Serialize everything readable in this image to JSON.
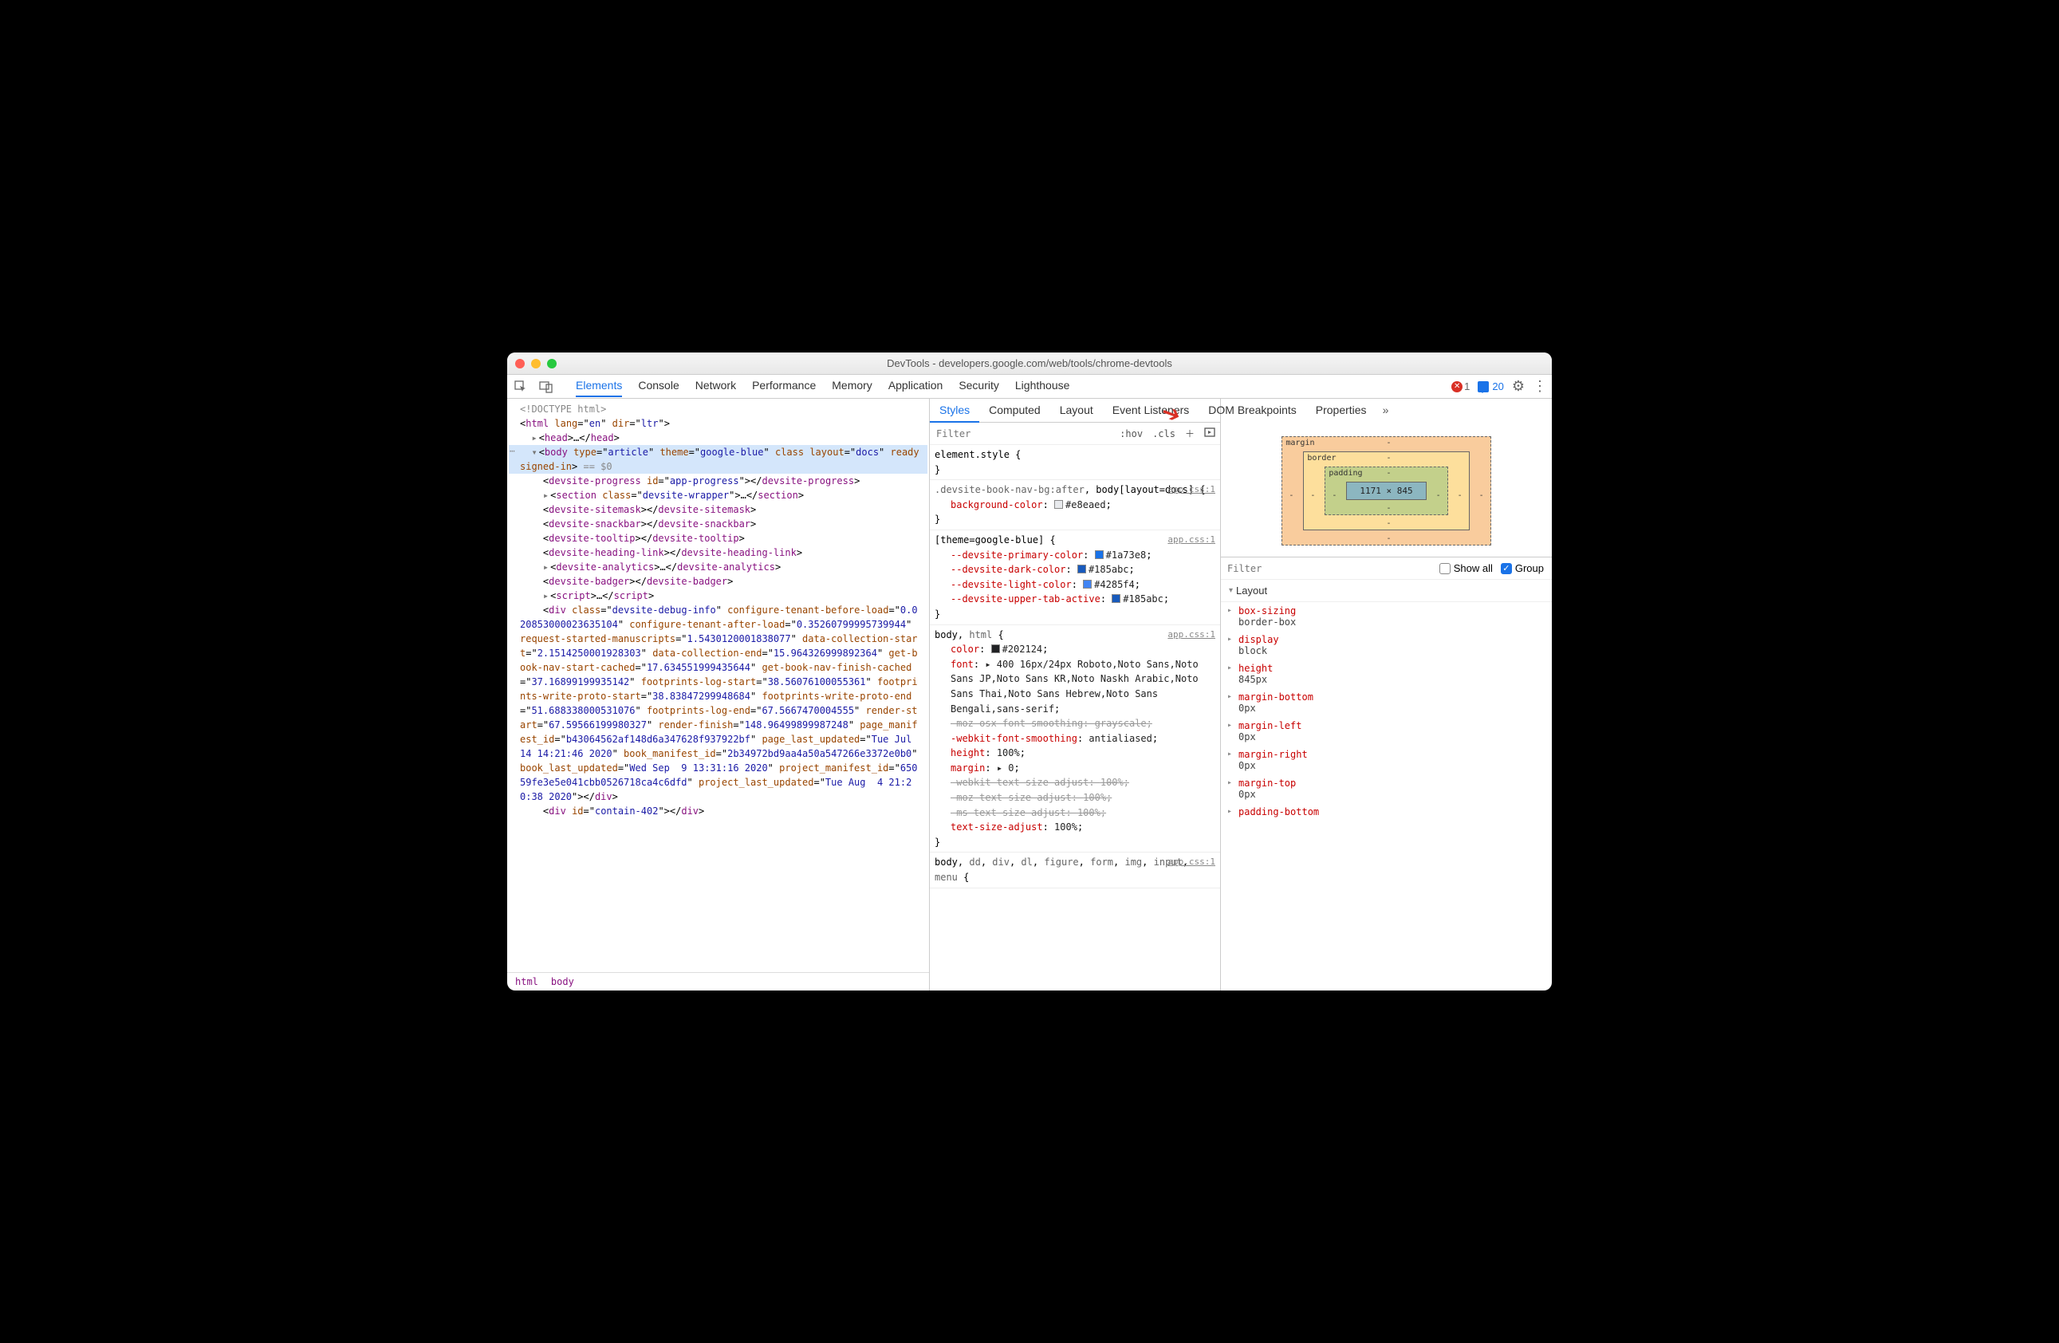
{
  "window": {
    "title": "DevTools - developers.google.com/web/tools/chrome-devtools"
  },
  "toolbar": {
    "tabs": [
      "Elements",
      "Console",
      "Network",
      "Performance",
      "Memory",
      "Application",
      "Security",
      "Lighthouse"
    ],
    "active_tab": "Elements",
    "error_count": "1",
    "message_count": "20"
  },
  "styles_panel": {
    "tabs": [
      "Styles",
      "Computed",
      "Layout",
      "Event Listeners",
      "DOM Breakpoints",
      "Properties"
    ],
    "active": "Styles",
    "filter_placeholder": "Filter",
    "hov": ":hov",
    "cls": ".cls"
  },
  "breadcrumb": [
    "html",
    "body"
  ],
  "dom_lines": [
    {
      "indent": 0,
      "html": "<span class='gray'>&lt;!DOCTYPE html&gt;</span>"
    },
    {
      "indent": 0,
      "html": "&lt;<span class='tag'>html</span> <span class='attr-n'>lang</span>=\"<span class='attr-v'>en</span>\" <span class='attr-n'>dir</span>=\"<span class='attr-v'>ltr</span>\"&gt;"
    },
    {
      "indent": 1,
      "tri": "▸",
      "html": "&lt;<span class='tag'>head</span>&gt;…&lt;/<span class='tag'>head</span>&gt;"
    },
    {
      "indent": 1,
      "tri": "▾",
      "selected": true,
      "html": "&lt;<span class='tag'>body</span> <span class='attr-n'>type</span>=\"<span class='attr-v'>article</span>\" <span class='attr-n'>theme</span>=\"<span class='attr-v'>google-blue</span>\" <span class='attr-n'>class</span> <span class='attr-n'>layout</span>=\"<span class='attr-v'>docs</span>\" <span class='attr-n'>ready</span> <span class='attr-n'>signed-in</span>&gt; <span class='gray'>== $0</span>"
    },
    {
      "indent": 2,
      "html": "&lt;<span class='tag'>devsite-progress</span> <span class='attr-n'>id</span>=\"<span class='attr-v'>app-progress</span>\"&gt;&lt;/<span class='tag'>devsite-progress</span>&gt;"
    },
    {
      "indent": 2,
      "tri": "▸",
      "html": "&lt;<span class='tag'>section</span> <span class='attr-n'>class</span>=\"<span class='attr-v'>devsite-wrapper</span>\"&gt;…&lt;/<span class='tag'>section</span>&gt;"
    },
    {
      "indent": 2,
      "html": "&lt;<span class='tag'>devsite-sitemask</span>&gt;&lt;/<span class='tag'>devsite-sitemask</span>&gt;"
    },
    {
      "indent": 2,
      "html": "&lt;<span class='tag'>devsite-snackbar</span>&gt;&lt;/<span class='tag'>devsite-snackbar</span>&gt;"
    },
    {
      "indent": 2,
      "html": "&lt;<span class='tag'>devsite-tooltip</span>&gt;&lt;/<span class='tag'>devsite-tooltip</span>&gt;"
    },
    {
      "indent": 2,
      "html": "&lt;<span class='tag'>devsite-heading-link</span>&gt;&lt;/<span class='tag'>devsite-heading-link</span>&gt;"
    },
    {
      "indent": 2,
      "tri": "▸",
      "html": "&lt;<span class='tag'>devsite-analytics</span>&gt;…&lt;/<span class='tag'>devsite-analytics</span>&gt;"
    },
    {
      "indent": 2,
      "html": "&lt;<span class='tag'>devsite-badger</span>&gt;&lt;/<span class='tag'>devsite-badger</span>&gt;"
    },
    {
      "indent": 2,
      "tri": "▸",
      "html": "&lt;<span class='tag'>script</span>&gt;…&lt;/<span class='tag'>script</span>&gt;"
    },
    {
      "indent": 2,
      "html": "&lt;<span class='tag'>div</span> <span class='attr-n'>class</span>=\"<span class='attr-v'>devsite-debug-info</span>\" <span class='attr-n'>configure-tenant-before-load</span>=\"<span class='attr-v'>0.020853000023635104</span>\" <span class='attr-n'>configure-tenant-after-load</span>=\"<span class='attr-v'>0.35260799995739944</span>\" <span class='attr-n'>request-started-manuscripts</span>=\"<span class='attr-v'>1.5430120001838077</span>\" <span class='attr-n'>data-collection-start</span>=\"<span class='attr-v'>2.1514250001928303</span>\" <span class='attr-n'>data-collection-end</span>=\"<span class='attr-v'>15.964326999892364</span>\" <span class='attr-n'>get-book-nav-start-cached</span>=\"<span class='attr-v'>17.634551999435644</span>\" <span class='attr-n'>get-book-nav-finish-cached</span>=\"<span class='attr-v'>37.16899199935142</span>\" <span class='attr-n'>footprints-log-start</span>=\"<span class='attr-v'>38.56076100055361</span>\" <span class='attr-n'>footprints-write-proto-start</span>=\"<span class='attr-v'>38.83847299948684</span>\" <span class='attr-n'>footprints-write-proto-end</span>=\"<span class='attr-v'>51.688338000531076</span>\" <span class='attr-n'>footprints-log-end</span>=\"<span class='attr-v'>67.5667470004555</span>\" <span class='attr-n'>render-start</span>=\"<span class='attr-v'>67.59566199980327</span>\" <span class='attr-n'>render-finish</span>=\"<span class='attr-v'>148.96499899987248</span>\" <span class='attr-n'>page_manifest_id</span>=\"<span class='attr-v'>b43064562af148d6a347628f937922bf</span>\" <span class='attr-n'>page_last_updated</span>=\"<span class='attr-v'>Tue Jul 14 14:21:46 2020</span>\" <span class='attr-n'>book_manifest_id</span>=\"<span class='attr-v'>2b34972bd9aa4a50a547266e3372e0b0</span>\" <span class='attr-n'>book_last_updated</span>=\"<span class='attr-v'>Wed Sep  9 13:31:16 2020</span>\" <span class='attr-n'>project_manifest_id</span>=\"<span class='attr-v'>65059fe3e5e041cbb0526718ca4c6dfd</span>\" <span class='attr-n'>project_last_updated</span>=\"<span class='attr-v'>Tue Aug  4 21:20:38 2020</span>\"&gt;&lt;/<span class='tag'>div</span>&gt;"
    },
    {
      "indent": 2,
      "html": "&lt;<span class='tag'>div</span> <span class='attr-n'>id</span>=\"<span class='attr-v'>contain-402</span>\"&gt;&lt;/<span class='tag'>div</span>&gt;"
    }
  ],
  "rules": [
    {
      "selector_html": "<span class='selector match'>element.style</span> {",
      "src": "",
      "props": [],
      "close": "}"
    },
    {
      "selector_html": "<span class='selector'>.devsite-book-nav-bg:after</span>, <span class='selector match'>body[layout=docs]</span> {",
      "src": "app.css:1",
      "props": [
        {
          "n": "background-color",
          "v": "<span class='swatch' style='background:#e8eaed'></span>#e8eaed"
        }
      ],
      "close": "}"
    },
    {
      "selector_html": "<span class='selector match'>[theme=google-blue]</span> {",
      "src": "app.css:1",
      "props": [
        {
          "var": true,
          "n": "--devsite-primary-color",
          "v": "<span class='swatch' style='background:#1a73e8'></span>#1a73e8"
        },
        {
          "var": true,
          "n": "--devsite-dark-color",
          "v": "<span class='swatch' style='background:#185abc'></span>#185abc"
        },
        {
          "var": true,
          "n": "--devsite-light-color",
          "v": "<span class='swatch' style='background:#4285f4'></span>#4285f4"
        },
        {
          "var": true,
          "n": "--devsite-upper-tab-active",
          "v": "<span class='swatch' style='background:#185abc'></span>#185abc"
        }
      ],
      "close": "}"
    },
    {
      "selector_html": "<span class='selector match'>body</span>, <span class='selector'>html</span> {",
      "src": "app.css:1",
      "props": [
        {
          "n": "color",
          "v": "<span class='swatch' style='background:#202124'></span>#202124"
        },
        {
          "n": "font",
          "v": "▸ 400 16px/24px Roboto,Noto Sans,Noto Sans JP,Noto Sans KR,Noto Naskh Arabic,Noto Sans Thai,Noto Sans Hebrew,Noto Sans Bengali,sans-serif"
        },
        {
          "strike": true,
          "n": "-moz-osx-font-smoothing",
          "v": "grayscale"
        },
        {
          "n": "-webkit-font-smoothing",
          "v": "antialiased"
        },
        {
          "n": "height",
          "v": "100%"
        },
        {
          "n": "margin",
          "v": "▸ 0"
        },
        {
          "strike": true,
          "n": "-webkit-text-size-adjust",
          "v": "100%"
        },
        {
          "strike": true,
          "n": "-moz-text-size-adjust",
          "v": "100%"
        },
        {
          "strike": true,
          "n": "-ms-text-size-adjust",
          "v": "100%"
        },
        {
          "n": "text-size-adjust",
          "v": "100%"
        }
      ],
      "close": "}"
    },
    {
      "selector_html": "<span class='selector match'>body</span>, <span class='selector'>dd</span>, <span class='selector'>div</span>, <span class='selector'>dl</span>, <span class='selector'>figure</span>, <span class='selector'>form</span>, <span class='selector'>img</span>, <span class='selector'>input</span>, <span class='selector'>menu</span> {",
      "src": "app.css:1",
      "props": [],
      "close": ""
    }
  ],
  "box_model": {
    "margin": "margin",
    "border": "border",
    "padding": "padding",
    "content": "1171 × 845",
    "dash": "-"
  },
  "computed": {
    "filter_placeholder": "Filter",
    "show_all": "Show all",
    "group": "Group",
    "section": "Layout",
    "props": [
      {
        "n": "box-sizing",
        "v": "border-box"
      },
      {
        "n": "display",
        "v": "block"
      },
      {
        "n": "height",
        "v": "845px"
      },
      {
        "n": "margin-bottom",
        "v": "0px"
      },
      {
        "n": "margin-left",
        "v": "0px"
      },
      {
        "n": "margin-right",
        "v": "0px"
      },
      {
        "n": "margin-top",
        "v": "0px"
      },
      {
        "n": "padding-bottom",
        "v": ""
      }
    ]
  }
}
